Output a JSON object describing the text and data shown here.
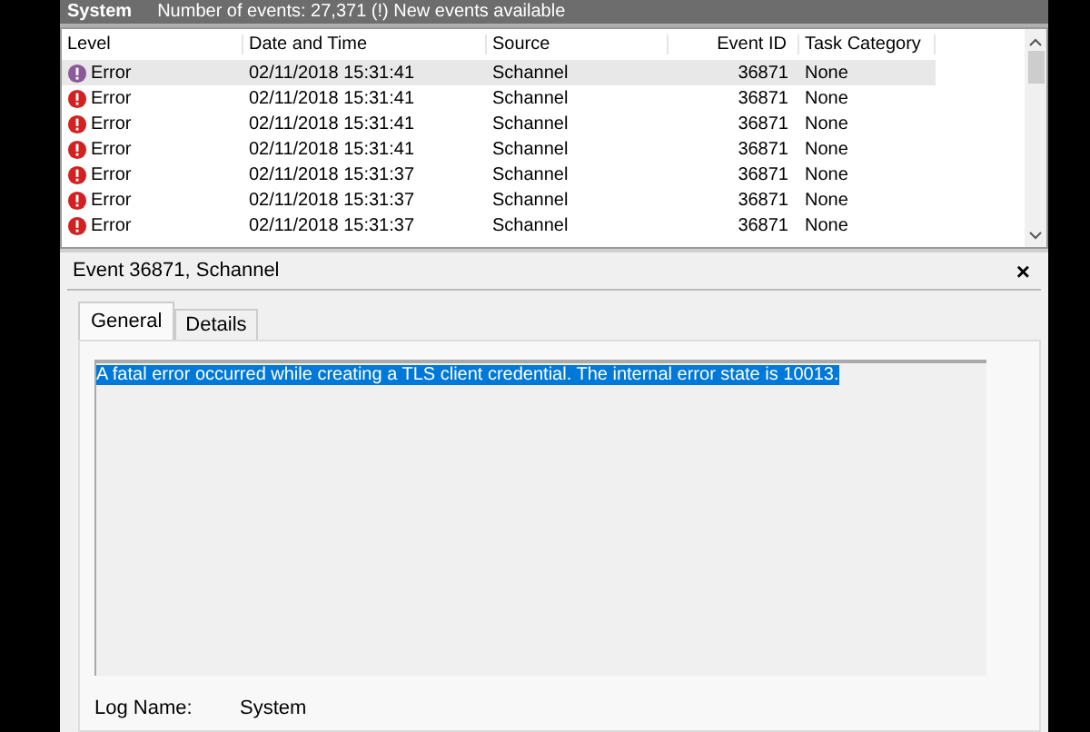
{
  "header": {
    "title": "System",
    "status": "Number of events: 27,371 (!) New events available"
  },
  "table": {
    "columns": [
      "Level",
      "Date and Time",
      "Source",
      "Event ID",
      "Task Category"
    ],
    "rows": [
      {
        "level": "Error",
        "date": "02/11/2018 15:31:41",
        "source": "Schannel",
        "event_id": "36871",
        "category": "None",
        "selected": true
      },
      {
        "level": "Error",
        "date": "02/11/2018 15:31:41",
        "source": "Schannel",
        "event_id": "36871",
        "category": "None",
        "selected": false
      },
      {
        "level": "Error",
        "date": "02/11/2018 15:31:41",
        "source": "Schannel",
        "event_id": "36871",
        "category": "None",
        "selected": false
      },
      {
        "level": "Error",
        "date": "02/11/2018 15:31:41",
        "source": "Schannel",
        "event_id": "36871",
        "category": "None",
        "selected": false
      },
      {
        "level": "Error",
        "date": "02/11/2018 15:31:37",
        "source": "Schannel",
        "event_id": "36871",
        "category": "None",
        "selected": false
      },
      {
        "level": "Error",
        "date": "02/11/2018 15:31:37",
        "source": "Schannel",
        "event_id": "36871",
        "category": "None",
        "selected": false
      },
      {
        "level": "Error",
        "date": "02/11/2018 15:31:37",
        "source": "Schannel",
        "event_id": "36871",
        "category": "None",
        "selected": false
      }
    ]
  },
  "detail": {
    "title": "Event 36871, Schannel",
    "close": "×",
    "tabs": [
      {
        "label": "General",
        "selected": true
      },
      {
        "label": "Details",
        "selected": false
      }
    ],
    "message": "A fatal error occurred while creating a TLS client credential. The internal error state is 10013.",
    "fields": [
      {
        "label": "Log Name:",
        "value": "System"
      }
    ]
  }
}
